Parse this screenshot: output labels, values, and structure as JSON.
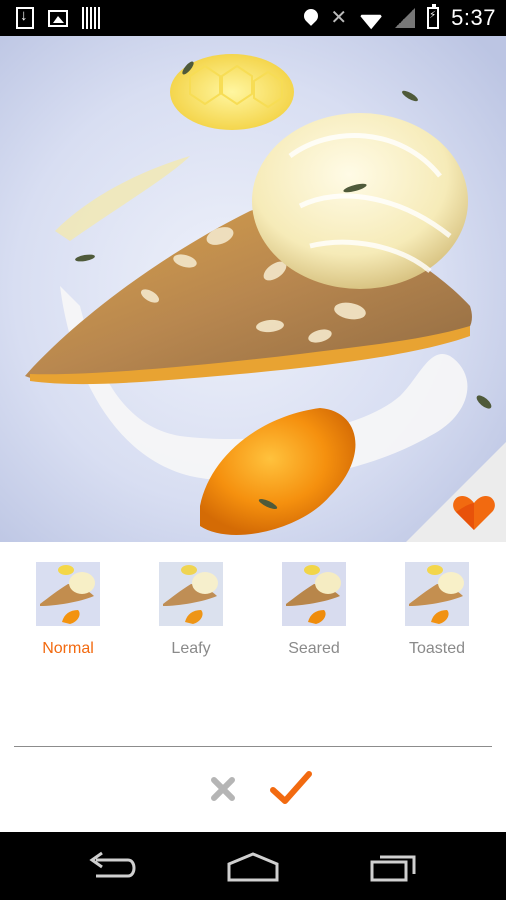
{
  "status_bar": {
    "time": "5:37",
    "left_icons": [
      "download-icon",
      "image-icon",
      "barcode-icon"
    ],
    "right_icons": [
      "location-icon",
      "vibrate-off-icon",
      "wifi-icon",
      "signal-icon",
      "battery-charging-icon"
    ]
  },
  "photo": {
    "subject_icon": "dessert-photo",
    "badge_icon": "heart-logo-icon"
  },
  "filters": [
    {
      "label": "Normal",
      "selected": true
    },
    {
      "label": "Leafy",
      "selected": false
    },
    {
      "label": "Seared",
      "selected": false
    },
    {
      "label": "Toasted",
      "selected": false
    }
  ],
  "actions": {
    "cancel_icon": "close-icon",
    "confirm_icon": "checkmark-icon"
  },
  "colors": {
    "accent": "#f26a10",
    "inactive": "#8a8a8a",
    "cancel": "#b5b5b5"
  },
  "nav_bar": {
    "icons": [
      "back-icon",
      "home-icon",
      "recent-apps-icon"
    ]
  }
}
